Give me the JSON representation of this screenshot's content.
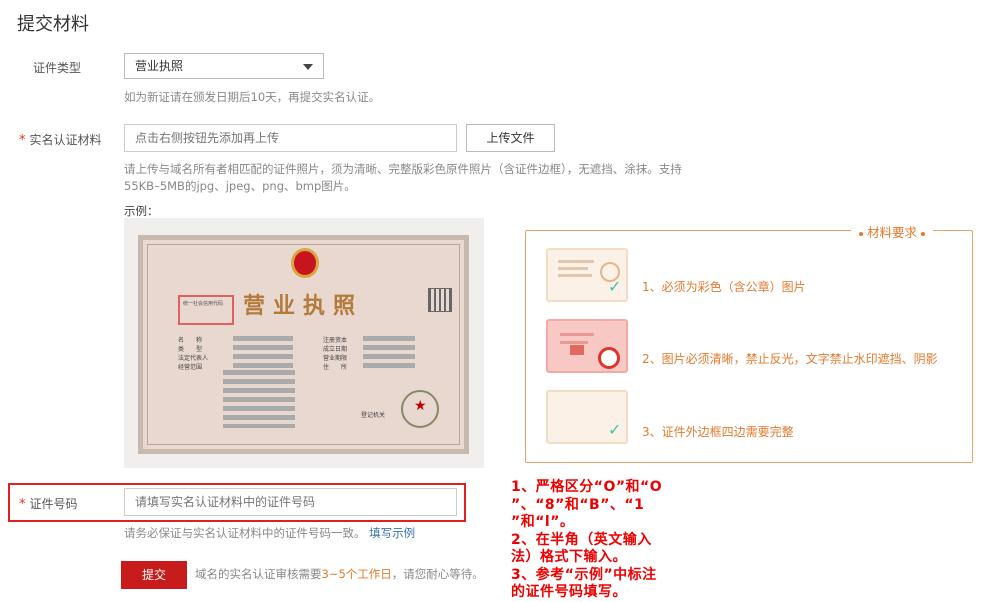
{
  "page": {
    "title": "提交材料"
  },
  "cert_type": {
    "label": "证件类型",
    "selected": "营业执照",
    "hint": "如为新证请在颁发日期后10天，再提交实名认证。"
  },
  "material": {
    "required_mark": "*",
    "label": "实名认证材料",
    "placeholder": "点击右侧按钮先添加再上传",
    "upload_button": "上传文件",
    "hint_line1": "请上传与域名所有者相匹配的证件照片，须为清晰、完整版彩色原件照片（含证件边框），无遮挡、涂抹。支持",
    "hint_line2": "55KB–5MB的jpg、jpeg、png、bmp图片。",
    "example_label": "示例："
  },
  "certificate": {
    "title": "营业执照",
    "id_label": "统一社会信用代码",
    "rows_left": [
      "名　　称",
      "类　　型",
      "法定代表人",
      "经营范围"
    ],
    "rows_right": [
      "注册资本",
      "成立日期",
      "营业期限",
      "住　　所"
    ],
    "seal_label": "登记机关"
  },
  "requirements": {
    "legend": "材料要求",
    "items": [
      {
        "text": "1、必须为彩色（含公章）图片"
      },
      {
        "text": "2、图片必须清晰，禁止反光，文字禁止水印遮挡、阴影"
      },
      {
        "text": "3、证件外边框四边需要完整"
      }
    ]
  },
  "id_number": {
    "required_mark": "*",
    "label": "证件号码",
    "placeholder": "请填写实名认证材料中的证件号码",
    "hint": "请务必保证与实名认证材料中的证件号码一致。",
    "link": "填写示例"
  },
  "submit": {
    "button": "提交",
    "note_prefix": "域名的实名认证审核需要",
    "note_highlight": "3~5个工作日",
    "note_suffix": "，请您耐心等待。"
  },
  "annotation": {
    "lines": [
      "1、严格区分“O”和“O",
      "”、“8”和“B”、“1",
      "”和“l”。",
      "2、在半角（英文输入",
      "法）格式下输入。",
      "3、参考“示例”中标注",
      "的证件号码填写。"
    ]
  },
  "colors": {
    "accent_red": "#c81c1c",
    "orange": "#e47a2e",
    "link": "#3a6fb0"
  }
}
